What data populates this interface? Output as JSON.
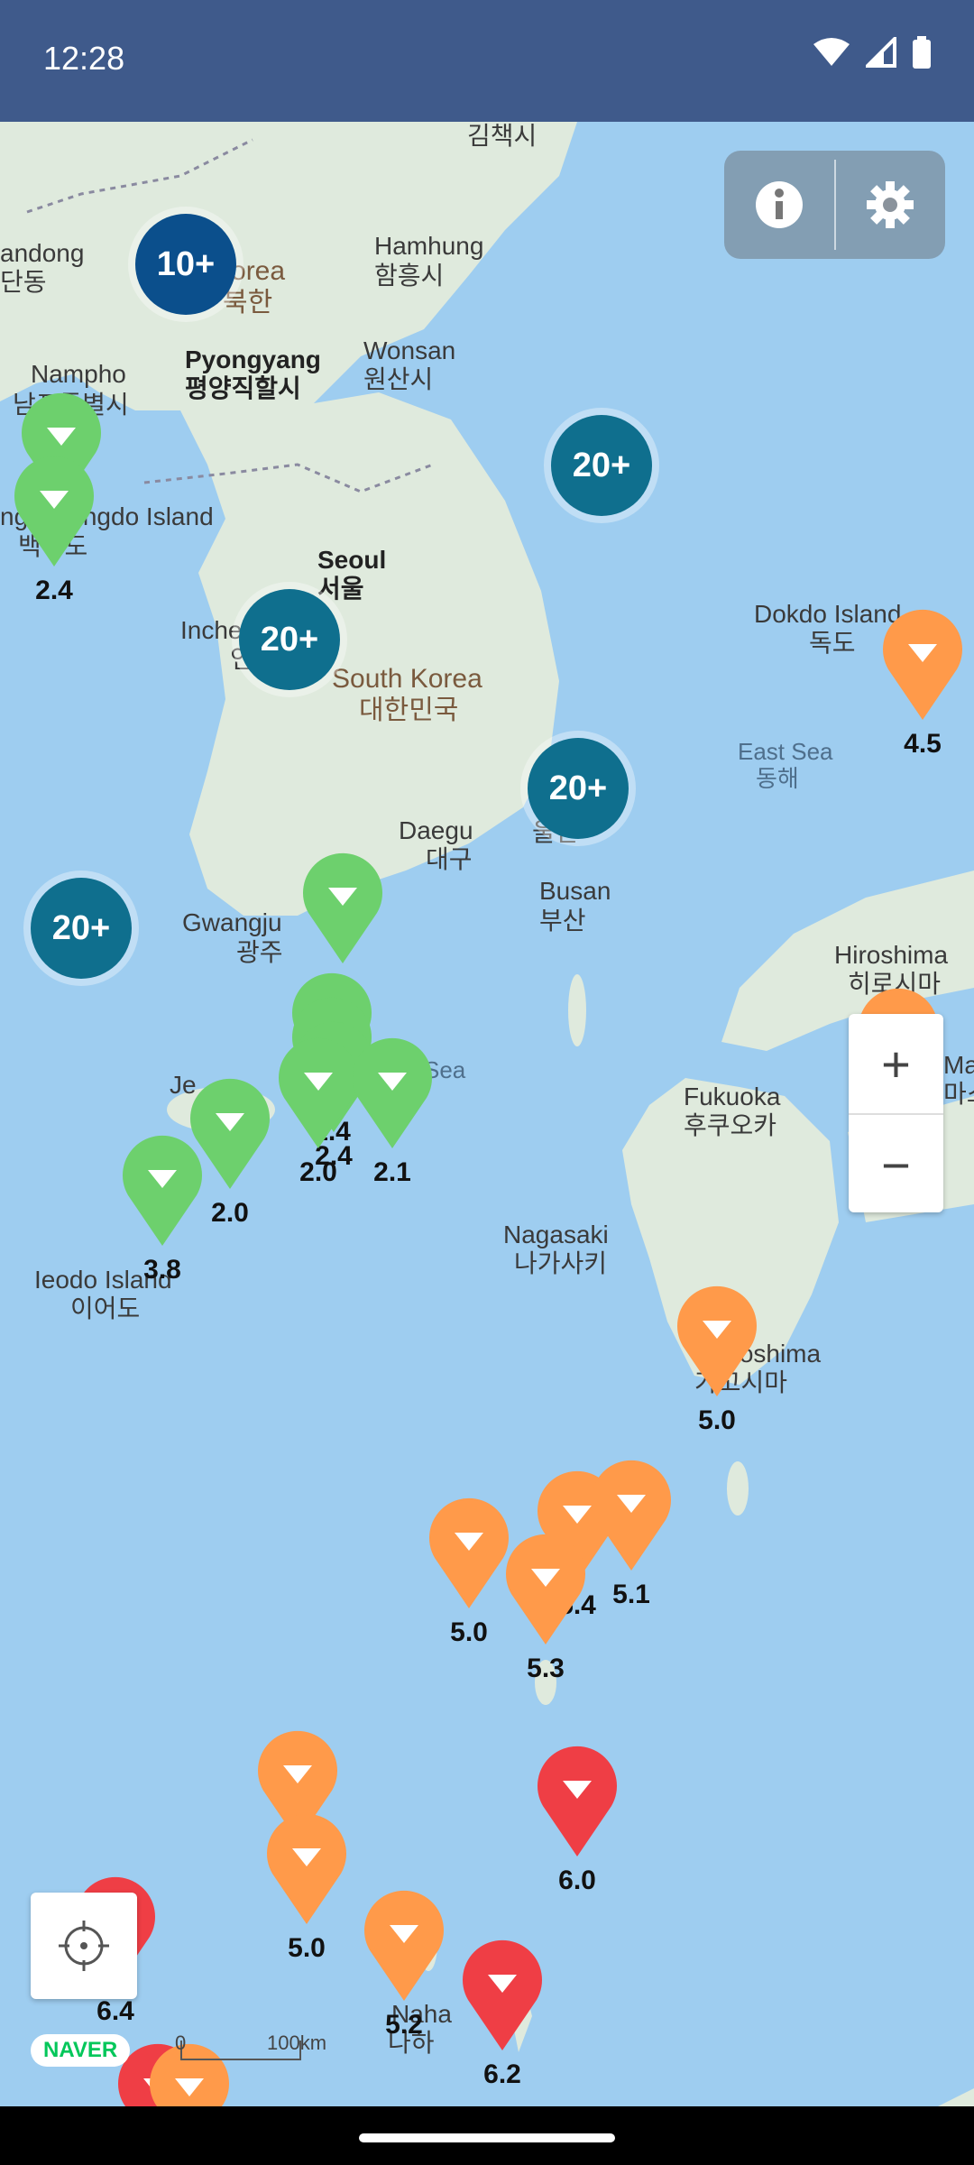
{
  "status_bar": {
    "time": "12:28",
    "icons": [
      "wifi-icon",
      "signal-icon",
      "battery-icon"
    ]
  },
  "colors": {
    "status_bar": "#3f5a8b",
    "cluster_dark": "#0b5a8f",
    "cluster_teal": "#0f6f8e",
    "green": "#6dd06d",
    "orange": "#ff9a4a",
    "red": "#ef3e45",
    "sea": "#9ecdf0",
    "land": "#dfeadd"
  },
  "map_labels": [
    {
      "text": "김책시",
      "cls": ""
    },
    {
      "text": "andong",
      "cls": ""
    },
    {
      "text": "단동",
      "cls": ""
    },
    {
      "text": "Korea",
      "cls": "brown"
    },
    {
      "text": "북한",
      "cls": "brown"
    },
    {
      "text": "Hamhung",
      "cls": ""
    },
    {
      "text": "함흥시",
      "cls": ""
    },
    {
      "text": "Pyongyang",
      "cls": "bold"
    },
    {
      "text": "평양직할시",
      "cls": "bold"
    },
    {
      "text": "Wonsan",
      "cls": ""
    },
    {
      "text": "원산시",
      "cls": ""
    },
    {
      "text": "Nampho",
      "cls": ""
    },
    {
      "text": "남포특별시",
      "cls": ""
    },
    {
      "text": "ngnyeongdo Island",
      "cls": ""
    },
    {
      "text": "백령도",
      "cls": ""
    },
    {
      "text": "Seoul",
      "cls": "bold"
    },
    {
      "text": "서울",
      "cls": "bold"
    },
    {
      "text": "Inche",
      "cls": ""
    },
    {
      "text": "인천",
      "cls": ""
    },
    {
      "text": "South Korea",
      "cls": "brown"
    },
    {
      "text": "대한민국",
      "cls": "brown"
    },
    {
      "text": "Dokdo Island",
      "cls": ""
    },
    {
      "text": "독도",
      "cls": ""
    },
    {
      "text": "East Sea",
      "cls": "sea"
    },
    {
      "text": "동해",
      "cls": "sea"
    },
    {
      "text": "Daegu",
      "cls": ""
    },
    {
      "text": "대구",
      "cls": ""
    },
    {
      "text": "울산",
      "cls": ""
    },
    {
      "text": "Busan",
      "cls": ""
    },
    {
      "text": "부산",
      "cls": ""
    },
    {
      "text": "Gwangju",
      "cls": ""
    },
    {
      "text": "광주",
      "cls": ""
    },
    {
      "text": "Hiroshima",
      "cls": ""
    },
    {
      "text": "히로시마",
      "cls": ""
    },
    {
      "text": "Ma",
      "cls": ""
    },
    {
      "text": "마스",
      "cls": ""
    },
    {
      "text": "Fukuoka",
      "cls": ""
    },
    {
      "text": "후쿠오카",
      "cls": ""
    },
    {
      "text": "Je",
      "cls": ""
    },
    {
      "text": "Sea",
      "cls": "sea"
    },
    {
      "text": "Nagasaki",
      "cls": ""
    },
    {
      "text": "나가사키",
      "cls": ""
    },
    {
      "text": "Ieodo Island",
      "cls": ""
    },
    {
      "text": "이어도",
      "cls": ""
    },
    {
      "text": "Kagoshima",
      "cls": ""
    },
    {
      "text": "가고시마",
      "cls": ""
    },
    {
      "text": "Naha",
      "cls": ""
    },
    {
      "text": "나하",
      "cls": ""
    }
  ],
  "clusters": [
    {
      "text": "10+",
      "color": "#0b4f8c"
    },
    {
      "text": "20+",
      "color": "#0f6f8e"
    },
    {
      "text": "20+",
      "color": "#0f6f8e"
    },
    {
      "text": "20+",
      "color": "#0f6f8e"
    },
    {
      "text": "20+",
      "color": "#0f6f8e"
    }
  ],
  "markers": [
    {
      "color": "#6dd06d",
      "value": ""
    },
    {
      "color": "#6dd06d",
      "value": "2.4"
    },
    {
      "color": "#6dd06d",
      "value": ""
    },
    {
      "color": "#6dd06d",
      "value": ""
    },
    {
      "color": "#6dd06d",
      "value": "1.4"
    },
    {
      "color": "#6dd06d",
      "value": "2.4"
    },
    {
      "color": "#6dd06d",
      "value": "2.0"
    },
    {
      "color": "#6dd06d",
      "value": "2.1"
    },
    {
      "color": "#6dd06d",
      "value": "2.0"
    },
    {
      "color": "#6dd06d",
      "value": "3.8"
    },
    {
      "color": "#ff9a4a",
      "value": "4.5"
    },
    {
      "color": "#ff9a4a",
      "value": ""
    },
    {
      "color": "#ff9a4a",
      "value": "5.0"
    },
    {
      "color": "#ff9a4a",
      "value": "5.0"
    },
    {
      "color": "#ff9a4a",
      "value": "5.4"
    },
    {
      "color": "#ff9a4a",
      "value": "5.1"
    },
    {
      "color": "#ff9a4a",
      "value": "5.3"
    },
    {
      "color": "#ff9a4a",
      "value": ""
    },
    {
      "color": "#ff9a4a",
      "value": "5.0"
    },
    {
      "color": "#ff9a4a",
      "value": "5.2"
    },
    {
      "color": "#ef3e45",
      "value": "6.0"
    },
    {
      "color": "#ef3e45",
      "value": "6.2"
    },
    {
      "color": "#ef3e45",
      "value": "6.4"
    },
    {
      "color": "#ef3e45",
      "value": ""
    },
    {
      "color": "#ff9a4a",
      "value": ""
    }
  ],
  "controls": {
    "info_icon": "info-icon",
    "settings_icon": "gear-icon",
    "zoom_in": "+",
    "zoom_out": "−",
    "locate_icon": "crosshair-icon"
  },
  "attribution": {
    "logo": "NAVER",
    "scale_zero": "0",
    "scale_label": "100km"
  }
}
